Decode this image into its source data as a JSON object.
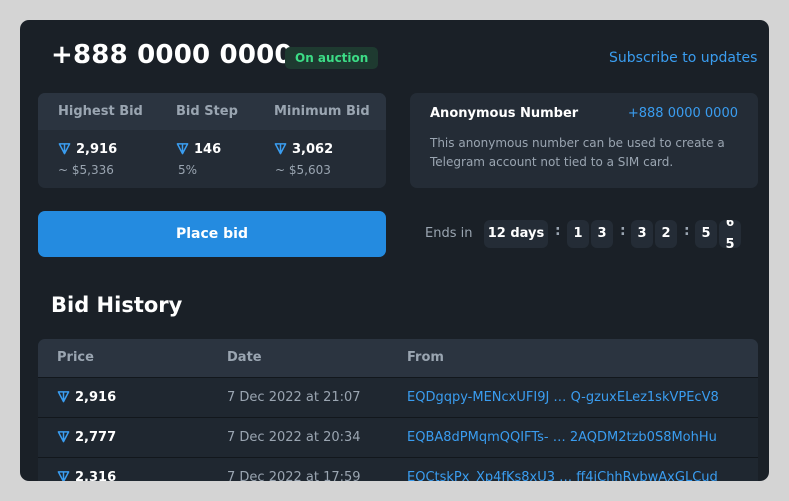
{
  "header": {
    "number": "+888 0000 0000",
    "status_badge": "On auction",
    "subscribe_link": "Subscribe to updates"
  },
  "stats": {
    "highest_bid": {
      "label": "Highest Bid",
      "value": "2,916",
      "usd": "~ $5,336"
    },
    "bid_step": {
      "label": "Bid Step",
      "value": "146",
      "percent": "5%"
    },
    "minimum_bid": {
      "label": "Minimum Bid",
      "value": "3,062",
      "usd": "~ $5,603"
    }
  },
  "anon": {
    "title": "Anonymous Number",
    "number": "+888 0000 0000",
    "description": "This anonymous number can be used to create a Telegram account not tied to a SIM card."
  },
  "actions": {
    "place_bid": "Place bid"
  },
  "countdown": {
    "label": "Ends in",
    "days": "12 days",
    "hours": [
      "1",
      "3"
    ],
    "minutes": [
      "3",
      "2"
    ],
    "seconds": [
      "5",
      "5"
    ],
    "seconds_rolling": "6"
  },
  "history": {
    "title": "Bid History",
    "columns": [
      "Price",
      "Date",
      "From"
    ],
    "rows": [
      {
        "price": "2,916",
        "date": "7 Dec 2022 at 21:07",
        "from_start": "EQDgqpy-MENcxUFI9J",
        "from_end": "Q-gzuxELez1skVPEcV8"
      },
      {
        "price": "2,777",
        "date": "7 Dec 2022 at 20:34",
        "from_start": "EQBA8dPMqmQQIFTs-",
        "from_end": "2AQDM2tzb0S8MohHu"
      },
      {
        "price": "2,316",
        "date": "7 Dec 2022 at 17:59",
        "from_start": "EQCtskPx_Xp4fKs8xU3",
        "from_end": "ff4iChhRvbwAxGLCud"
      }
    ]
  },
  "colors": {
    "accent": "#248be0",
    "link": "#3a9df0",
    "badge_green": "#3cdc86",
    "panel_bg": "#1a2027"
  },
  "icons": {
    "currency": "ton-diamond-icon"
  }
}
